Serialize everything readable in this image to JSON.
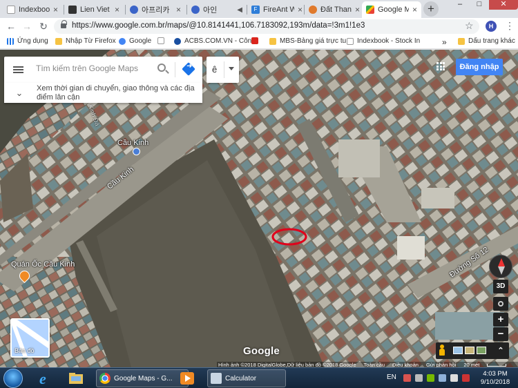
{
  "browser": {
    "tabs": [
      {
        "label": "Indexbook",
        "favicon_color": "#ffffff",
        "close": "×"
      },
      {
        "label": "Lien Viet",
        "favicon_color": "#333333",
        "close": "×"
      },
      {
        "label": "아프리카",
        "favicon_color": "#3b64c8",
        "close": "×"
      },
      {
        "label": "아인",
        "favicon_color": "#3b64c8",
        "close": "×"
      },
      {
        "label": "FireAnt W",
        "favicon_color": "#2f7ed8",
        "close": "×"
      },
      {
        "label": "Đất Thanh",
        "favicon_color": "#e07a2d",
        "close": "×"
      },
      {
        "label": "Google M",
        "favicon_color": "#34a853",
        "close": "×",
        "active": true
      }
    ],
    "new_tab": "+",
    "window_controls": {
      "minimize": "–",
      "maximize": "□",
      "close": "✕"
    },
    "back": "←",
    "forward": "→",
    "reload": "↻",
    "url": "https://www.google.com.br/maps/@10.8141441,106.7183092,193m/data=!3m1!1e3",
    "bookmark_star": "☆",
    "profile_initial": "H",
    "menu": "⋮"
  },
  "bookmarks": {
    "items": [
      {
        "label": "Ứng dụng",
        "icon": "apps-grid-icon",
        "color": "#1a73e8"
      },
      {
        "label": "Nhập Từ Firefox",
        "icon": "folder-icon",
        "color": "#f6c343"
      },
      {
        "label": "Google",
        "icon": "google-g-icon",
        "color": "#4285f4"
      },
      {
        "label": "",
        "icon": "page-icon",
        "color": "#cccccc"
      },
      {
        "label": "ACBS.COM.VN - Côn",
        "icon": "acbs-icon",
        "color": "#1a4fa0"
      },
      {
        "label": "",
        "icon": "flag-icon",
        "color": "#da251d"
      },
      {
        "label": "MBS-Bảng giá trực tu",
        "icon": "folder-icon",
        "color": "#f6c343"
      },
      {
        "label": "Indexbook - Stock In",
        "icon": "page-icon",
        "color": "#cccccc"
      }
    ],
    "overflow": "»",
    "other": {
      "label": "Dấu trang khác",
      "icon": "folder-icon",
      "color": "#f6c343"
    }
  },
  "map": {
    "search_placeholder": "Tìm kiếm trên Google Maps",
    "suggestion": "Xem thời gian di chuyển, giao thông và các địa điểm lân cận",
    "language": "ê",
    "login_button": "Đăng nhập",
    "labels": {
      "bridge_name": "Cầu Kinh",
      "road_name": "Cầu Kinh",
      "restaurant": "Quán Ốc Cầu Kinh",
      "street": "Đường Số 12",
      "canal": "Kinh Đà"
    },
    "minimap_label": "Bản đồ",
    "logo": "Google",
    "controls": {
      "tilt": "3D",
      "zoom_in": "+",
      "zoom_out": "−",
      "expand": "⌃"
    },
    "attribution": [
      "Hình ảnh ©2018 DigitalGlobe,Dữ liệu bản đồ ©2018 Google",
      "Toàn cầu",
      "Điều khoản",
      "Gửi phản hồi",
      "20 mét"
    ],
    "accent": "#4285f4",
    "marker_color": "#e0001b"
  },
  "taskbar": {
    "buttons": [
      {
        "label": "Google Maps - G...",
        "icon": "chrome-icon"
      },
      {
        "label": "Calculator",
        "icon": "calculator-icon"
      }
    ],
    "language": "EN",
    "time": "4:03 PM",
    "date": "9/10/2018"
  }
}
